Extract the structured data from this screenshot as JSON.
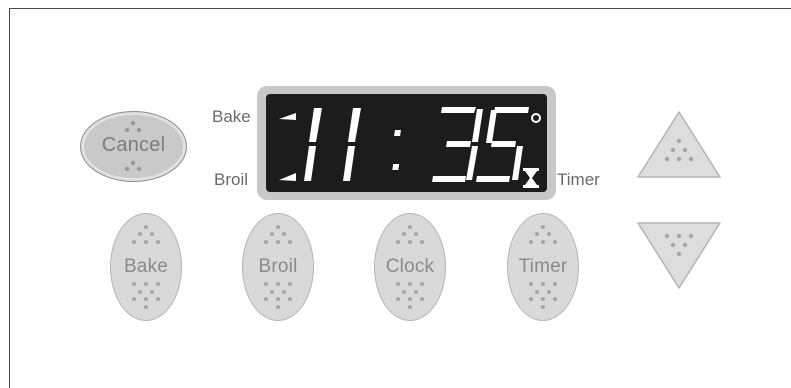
{
  "control_panel": {
    "display": {
      "time": "11:35",
      "mode_labels": {
        "bake": "Bake",
        "broil": "Broil",
        "timer": "Timer"
      }
    },
    "buttons": {
      "cancel": "Cancel",
      "bake": "Bake",
      "broil": "Broil",
      "clock": "Clock",
      "timer": "Timer"
    },
    "colors": {
      "display_background": "#1c1c1c",
      "segment_color": "#ffffff",
      "button_fill": "#d9d9d9",
      "label_color": "#8a8a8a"
    }
  }
}
